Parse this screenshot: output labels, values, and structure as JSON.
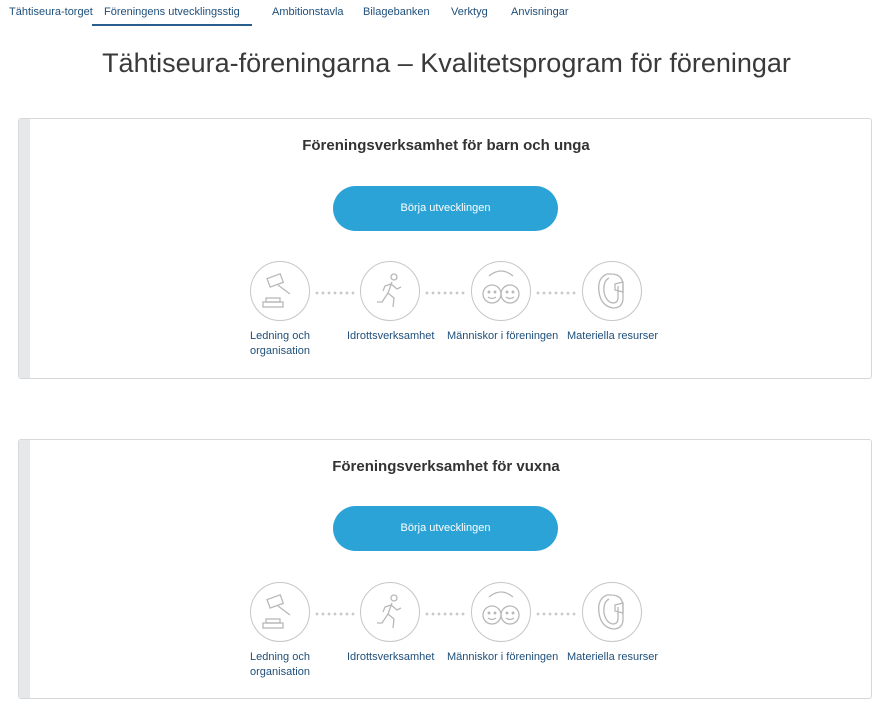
{
  "nav": {
    "tabs": [
      {
        "label": "Tähtiseura-torget"
      },
      {
        "label": "Föreningens utvecklingsstig",
        "active": true
      },
      {
        "label": "Ambitionstavla"
      },
      {
        "label": "Bilagebanken"
      },
      {
        "label": "Verktyg"
      },
      {
        "label": "Anvisningar"
      }
    ]
  },
  "page_title": "Tähtiseura-föreningarna – Kvalitetsprogram för föreningar",
  "cards": [
    {
      "title": "Föreningsverksamhet för barn och unga",
      "button_label": "Börja utvecklingen",
      "steps": [
        {
          "label_line1": "Ledning och",
          "label_line2": "organisation",
          "icon": "gavel-icon"
        },
        {
          "label_line1": "Idrottsverksamhet",
          "label_line2": "",
          "icon": "runner-icon"
        },
        {
          "label_line1": "Människor i föreningen",
          "label_line2": "",
          "icon": "smiley-faces-icon"
        },
        {
          "label_line1": "Materiella resurser",
          "label_line2": "",
          "icon": "carabiner-icon"
        }
      ]
    },
    {
      "title": "Föreningsverksamhet för vuxna",
      "button_label": "Börja utvecklingen",
      "steps": [
        {
          "label_line1": "Ledning och",
          "label_line2": "organisation",
          "icon": "gavel-icon"
        },
        {
          "label_line1": "Idrottsverksamhet",
          "label_line2": "",
          "icon": "runner-icon"
        },
        {
          "label_line1": "Människor i föreningen",
          "label_line2": "",
          "icon": "smiley-faces-icon"
        },
        {
          "label_line1": "Materiella resurser",
          "label_line2": "",
          "icon": "carabiner-icon"
        }
      ]
    }
  ],
  "colors": {
    "accent": "#2ba3d6",
    "link": "#1e4f7a",
    "icon_stroke": "#c6c6c6"
  }
}
